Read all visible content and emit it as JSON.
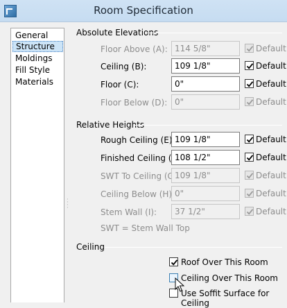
{
  "window": {
    "title": "Room Specification"
  },
  "nav": {
    "items": [
      "General",
      "Structure",
      "Moldings",
      "Fill Style",
      "Materials"
    ],
    "selected": "Structure"
  },
  "absolute_elevations": {
    "header": "Absolute Elevations",
    "floor_above": {
      "label": "Floor Above (A):",
      "value": "114 5/8\"",
      "default_label": "Default",
      "default_checked": true
    },
    "ceiling": {
      "label": "Ceiling (B):",
      "value": "109 1/8\"",
      "default_label": "Default",
      "default_checked": true
    },
    "floor": {
      "label": "Floor (C):",
      "value": "0\"",
      "default_label": "Default",
      "default_checked": true
    },
    "floor_below": {
      "label": "Floor Below (D):",
      "value": "0\"",
      "default_label": "Default",
      "default_checked": true
    }
  },
  "relative_heights": {
    "header": "Relative Heights",
    "rough_ceiling": {
      "label": "Rough Ceiling (E):",
      "value": "109 1/8\"",
      "default_label": "Default",
      "default_checked": true
    },
    "finished_ceiling": {
      "label": "Finished Ceiling (F):",
      "value": "108 1/2\"",
      "default_label": "Default",
      "default_checked": true
    },
    "swt_to_ceiling": {
      "label": "SWT To Ceiling (G):",
      "value": "109 1/8\"",
      "default_label": "Default",
      "default_checked": true
    },
    "ceiling_below": {
      "label": "Ceiling Below (H):",
      "value": "0\"",
      "default_label": "Default",
      "default_checked": true
    },
    "stem_wall": {
      "label": "Stem Wall (I):",
      "value": "37 1/2\"",
      "default_label": "Default",
      "default_checked": true
    },
    "note": "SWT = Stem Wall Top"
  },
  "ceiling_group": {
    "header": "Ceiling",
    "roof_over_room": {
      "label": "Roof Over This Room",
      "checked": true
    },
    "ceiling_over_room": {
      "label": "Ceiling Over This Room",
      "checked": false
    },
    "use_soffit": {
      "label": "Use Soffit Surface for Ceiling",
      "checked": false
    }
  }
}
